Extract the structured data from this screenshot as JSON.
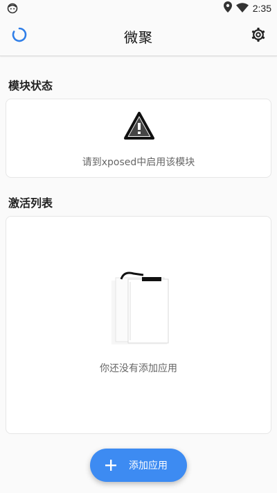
{
  "status_bar": {
    "time": "2:35",
    "left_icon": "notification-face-icon",
    "right_icons": [
      "location-icon",
      "wifi-icon"
    ]
  },
  "app_bar": {
    "title": "微聚",
    "left_icon": "loading-spinner-icon",
    "right_icon": "gear-icon"
  },
  "module_status": {
    "section_title": "模块状态",
    "icon": "warning-icon",
    "message": "请到xposed中启用该模块"
  },
  "active_list": {
    "section_title": "激活列表",
    "illustration": "empty-clipboard-icon",
    "empty_message": "你还没有添加应用"
  },
  "fab": {
    "label": "添加应用",
    "icon": "plus-icon",
    "color": "#3d8bf2"
  },
  "colors": {
    "background": "#fafafa",
    "card": "#ffffff",
    "accent": "#3d8bf2"
  }
}
